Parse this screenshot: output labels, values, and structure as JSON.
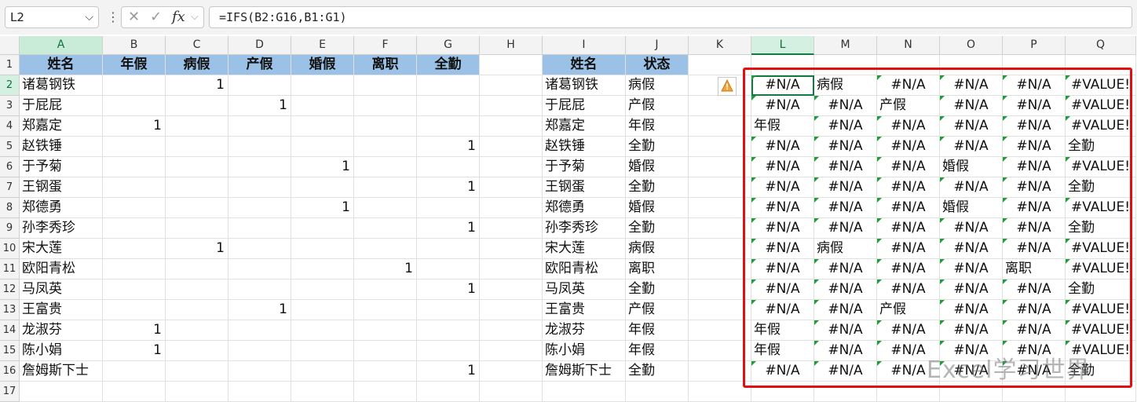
{
  "formula_bar": {
    "name_box": "L2",
    "formula": "=IFS(B2:G16,B1:G1)",
    "cancel_icon": "close-icon",
    "enter_icon": "check-icon",
    "fx_label": "fx"
  },
  "columns": [
    "A",
    "B",
    "C",
    "D",
    "E",
    "F",
    "G",
    "H",
    "I",
    "J",
    "K",
    "L",
    "M",
    "N",
    "O",
    "P",
    "Q"
  ],
  "rows": [
    "1",
    "2",
    "3",
    "4",
    "5",
    "6",
    "7",
    "8",
    "9",
    "10",
    "11",
    "12",
    "13",
    "14",
    "15",
    "16",
    "17"
  ],
  "table1": {
    "headers": [
      "姓名",
      "年假",
      "病假",
      "产假",
      "婚假",
      "离职",
      "全勤"
    ],
    "rows": [
      [
        "诸葛钢铁",
        "",
        "1",
        "",
        "",
        "",
        ""
      ],
      [
        "于屁屁",
        "",
        "",
        "1",
        "",
        "",
        ""
      ],
      [
        "郑嘉定",
        "1",
        "",
        "",
        "",
        "",
        ""
      ],
      [
        "赵铁锤",
        "",
        "",
        "",
        "",
        "",
        "1"
      ],
      [
        "于予菊",
        "",
        "",
        "",
        "1",
        "",
        ""
      ],
      [
        "王钢蛋",
        "",
        "",
        "",
        "",
        "",
        "1"
      ],
      [
        "郑德勇",
        "",
        "",
        "",
        "1",
        "",
        ""
      ],
      [
        "孙李秀珍",
        "",
        "",
        "",
        "",
        "",
        "1"
      ],
      [
        "宋大莲",
        "",
        "1",
        "",
        "",
        "",
        ""
      ],
      [
        "欧阳青松",
        "",
        "",
        "",
        "",
        "1",
        ""
      ],
      [
        "马凤英",
        "",
        "",
        "",
        "",
        "",
        "1"
      ],
      [
        "王富贵",
        "",
        "",
        "1",
        "",
        "",
        ""
      ],
      [
        "龙淑芬",
        "1",
        "",
        "",
        "",
        "",
        ""
      ],
      [
        "陈小娟",
        "1",
        "",
        "",
        "",
        "",
        ""
      ],
      [
        "詹姆斯下士",
        "",
        "",
        "",
        "",
        "",
        "1"
      ]
    ]
  },
  "table2": {
    "headers": [
      "姓名",
      "状态"
    ],
    "rows": [
      [
        "诸葛钢铁",
        "病假"
      ],
      [
        "于屁屁",
        "产假"
      ],
      [
        "郑嘉定",
        "年假"
      ],
      [
        "赵铁锤",
        "全勤"
      ],
      [
        "于予菊",
        "婚假"
      ],
      [
        "王钢蛋",
        "全勤"
      ],
      [
        "郑德勇",
        "婚假"
      ],
      [
        "孙李秀珍",
        "全勤"
      ],
      [
        "宋大莲",
        "病假"
      ],
      [
        "欧阳青松",
        "离职"
      ],
      [
        "马凤英",
        "全勤"
      ],
      [
        "王富贵",
        "产假"
      ],
      [
        "龙淑芬",
        "年假"
      ],
      [
        "陈小娟",
        "年假"
      ],
      [
        "詹姆斯下士",
        "全勤"
      ]
    ]
  },
  "results": [
    [
      "#N/A",
      "病假",
      "#N/A",
      "#N/A",
      "#N/A",
      "#VALUE!"
    ],
    [
      "#N/A",
      "#N/A",
      "产假",
      "#N/A",
      "#N/A",
      "#VALUE!"
    ],
    [
      "年假",
      "#N/A",
      "#N/A",
      "#N/A",
      "#N/A",
      "#VALUE!"
    ],
    [
      "#N/A",
      "#N/A",
      "#N/A",
      "#N/A",
      "#N/A",
      "全勤"
    ],
    [
      "#N/A",
      "#N/A",
      "#N/A",
      "婚假",
      "#N/A",
      "#VALUE!"
    ],
    [
      "#N/A",
      "#N/A",
      "#N/A",
      "#N/A",
      "#N/A",
      "全勤"
    ],
    [
      "#N/A",
      "#N/A",
      "#N/A",
      "婚假",
      "#N/A",
      "#VALUE!"
    ],
    [
      "#N/A",
      "#N/A",
      "#N/A",
      "#N/A",
      "#N/A",
      "全勤"
    ],
    [
      "#N/A",
      "病假",
      "#N/A",
      "#N/A",
      "#N/A",
      "#VALUE!"
    ],
    [
      "#N/A",
      "#N/A",
      "#N/A",
      "#N/A",
      "离职",
      "#VALUE!"
    ],
    [
      "#N/A",
      "#N/A",
      "#N/A",
      "#N/A",
      "#N/A",
      "全勤"
    ],
    [
      "#N/A",
      "#N/A",
      "产假",
      "#N/A",
      "#N/A",
      "#VALUE!"
    ],
    [
      "年假",
      "#N/A",
      "#N/A",
      "#N/A",
      "#N/A",
      "#VALUE!"
    ],
    [
      "年假",
      "#N/A",
      "#N/A",
      "#N/A",
      "#N/A",
      "#VALUE!"
    ],
    [
      "#N/A",
      "#N/A",
      "#N/A",
      "#N/A",
      "#N/A",
      "全勤"
    ]
  ],
  "error_indicator_icon": "warning-icon",
  "watermark": "Excel学习世界",
  "colors": {
    "header_fill": "#9bc2e6",
    "highlight_box": "#e01010",
    "selection": "#107c41"
  }
}
